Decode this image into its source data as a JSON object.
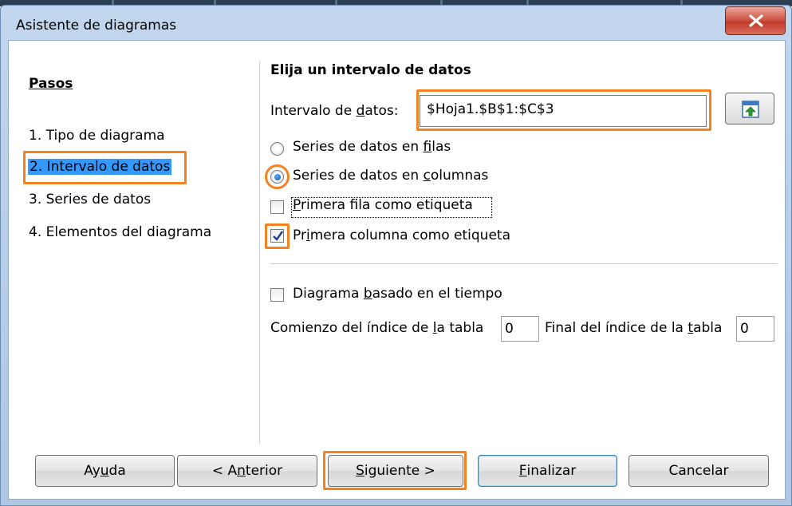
{
  "window": {
    "title": "Asistente de diagramas"
  },
  "steps": {
    "heading": "Pasos",
    "items": [
      {
        "label": "1. Tipo de diagrama",
        "selected": false
      },
      {
        "label": "2. Intervalo de datos",
        "selected": true
      },
      {
        "label": "3. Series de datos",
        "selected": false
      },
      {
        "label": "4. Elementos del diagrama",
        "selected": false
      }
    ]
  },
  "range": {
    "section_title": "Elija un intervalo de datos",
    "label_pre": "Intervalo de ",
    "label_u": "d",
    "label_post": "atos:",
    "value": "$Hoja1.$B$1:$C$3"
  },
  "options": {
    "rows_pre": "Series de datos en ",
    "rows_u": "f",
    "rows_post": "ilas",
    "cols_pre": "Series de datos en ",
    "cols_u": "c",
    "cols_post": "olumnas",
    "first_row_u": "P",
    "first_row_post": "rimera fila como etiqueta",
    "first_col_pre": "Pr",
    "first_col_u": "i",
    "first_col_post": "mera columna como etiqueta",
    "selected": "columns",
    "first_row_checked": false,
    "first_col_checked": true
  },
  "time_based": {
    "label_pre": "Diagrama ",
    "label_u": "b",
    "label_post": "asado en el tiempo",
    "checked": false,
    "start_pre": "Comienzo del índice de ",
    "start_u": "l",
    "start_post": "a tabla",
    "start_value": "0",
    "end_pre": "Final del índice de la ",
    "end_u": "t",
    "end_post": "abla",
    "end_value": "0"
  },
  "buttons": {
    "help_pre": "Ay",
    "help_u": "u",
    "help_post": "da",
    "back_pre": "< A",
    "back_u": "n",
    "back_post": "terior",
    "next_u": "S",
    "next_post": "iguiente >",
    "finish_u": "F",
    "finish_post": "inalizar",
    "cancel": "Cancelar"
  },
  "colors": {
    "highlight": "#f58220",
    "selection": "#3399ff"
  }
}
